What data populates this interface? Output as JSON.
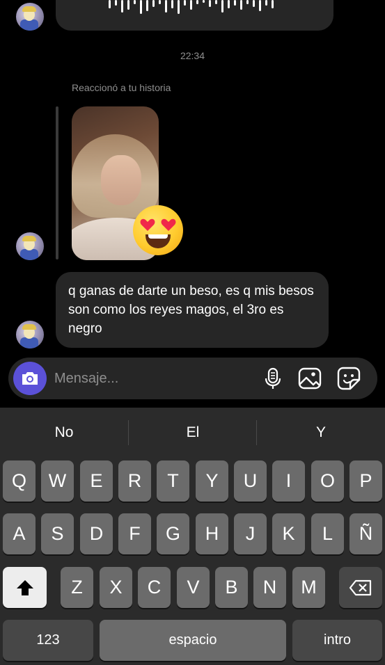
{
  "chat": {
    "timestamp": "22:34",
    "reaction_label": "Reaccionó a tu historia",
    "message_text": "q ganas de darte un beso, es q mis besos son como los reyes magos, el 3ro es negro"
  },
  "composer": {
    "placeholder": "Mensaje...",
    "icons": [
      "camera-icon",
      "microphone-icon",
      "gallery-icon",
      "sticker-icon"
    ],
    "camera_button_color": "#5b51d8"
  },
  "keyboard": {
    "suggestions": [
      "No",
      "El",
      "Y"
    ],
    "row1": [
      "Q",
      "W",
      "E",
      "R",
      "T",
      "Y",
      "U",
      "I",
      "O",
      "P"
    ],
    "row2": [
      "A",
      "S",
      "D",
      "F",
      "G",
      "H",
      "J",
      "K",
      "L",
      "Ñ"
    ],
    "row3": [
      "Z",
      "X",
      "C",
      "V",
      "B",
      "N",
      "M"
    ],
    "numbers_key": "123",
    "space_key": "espacio",
    "return_key": "intro"
  }
}
